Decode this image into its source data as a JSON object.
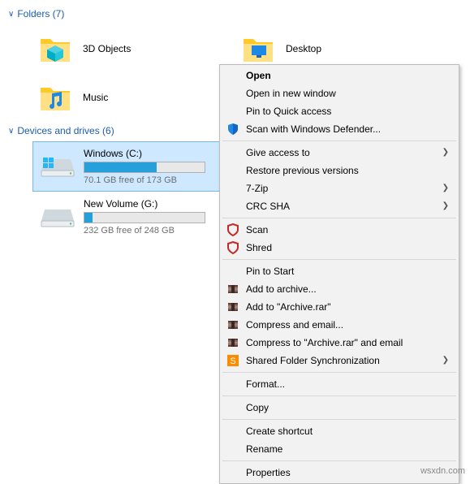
{
  "sections": {
    "folders": {
      "title": "Folders (7)"
    },
    "drives": {
      "title": "Devices and drives (6)"
    }
  },
  "folders": [
    {
      "label": "3D Objects",
      "icon": "folder-3d"
    },
    {
      "label": "Desktop",
      "icon": "folder-desktop"
    },
    {
      "label": "Music",
      "icon": "folder-music"
    }
  ],
  "drives": [
    {
      "name": "Windows (C:)",
      "free": "70.1 GB free of 173 GB",
      "fill_pct": 60,
      "selected": true,
      "icon": "windows-drive"
    },
    {
      "name": "New Volume (G:)",
      "free": "232 GB free of 248 GB",
      "fill_pct": 7,
      "selected": false,
      "icon": "drive"
    }
  ],
  "menu": [
    {
      "type": "item",
      "label": "Open",
      "bold": true
    },
    {
      "type": "item",
      "label": "Open in new window"
    },
    {
      "type": "item",
      "label": "Pin to Quick access"
    },
    {
      "type": "item",
      "label": "Scan with Windows Defender...",
      "icon": "defender-icon"
    },
    {
      "type": "sep"
    },
    {
      "type": "item",
      "label": "Give access to",
      "submenu": true
    },
    {
      "type": "item",
      "label": "Restore previous versions"
    },
    {
      "type": "item",
      "label": "7-Zip",
      "submenu": true
    },
    {
      "type": "item",
      "label": "CRC SHA",
      "submenu": true
    },
    {
      "type": "sep"
    },
    {
      "type": "item",
      "label": "Scan",
      "icon": "mcafee-icon"
    },
    {
      "type": "item",
      "label": "Shred",
      "icon": "mcafee-icon"
    },
    {
      "type": "sep"
    },
    {
      "type": "item",
      "label": "Pin to Start"
    },
    {
      "type": "item",
      "label": "Add to archive...",
      "icon": "winrar-icon"
    },
    {
      "type": "item",
      "label": "Add to \"Archive.rar\"",
      "icon": "winrar-icon"
    },
    {
      "type": "item",
      "label": "Compress and email...",
      "icon": "winrar-icon"
    },
    {
      "type": "item",
      "label": "Compress to \"Archive.rar\" and email",
      "icon": "winrar-icon"
    },
    {
      "type": "item",
      "label": "Shared Folder Synchronization",
      "icon": "sync-icon",
      "submenu": true
    },
    {
      "type": "sep"
    },
    {
      "type": "item",
      "label": "Format..."
    },
    {
      "type": "sep"
    },
    {
      "type": "item",
      "label": "Copy"
    },
    {
      "type": "sep"
    },
    {
      "type": "item",
      "label": "Create shortcut"
    },
    {
      "type": "item",
      "label": "Rename"
    },
    {
      "type": "sep"
    },
    {
      "type": "item",
      "label": "Properties"
    }
  ],
  "watermark": "wsxdn.com"
}
